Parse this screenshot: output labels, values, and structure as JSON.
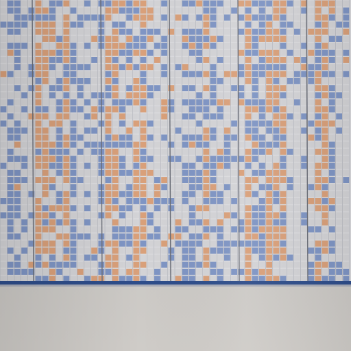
{
  "scene": {
    "subject": "wall-chart-grid",
    "palette": {
      "cell_empty": "#d3d3d6",
      "cell_blue": "#7f95c4",
      "cell_orange": "#d9a07a",
      "board_edge": "#2e4d8a",
      "grid_line": "#9ea1ab",
      "column_divider": "#6b6e78",
      "wall": "#c9c6c2"
    },
    "pattern_seed": 7
  }
}
